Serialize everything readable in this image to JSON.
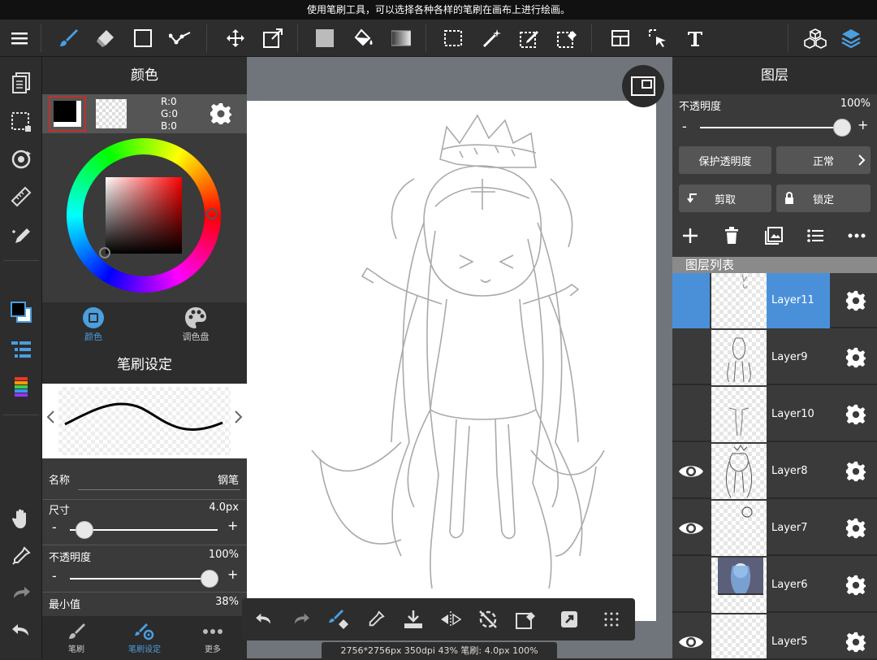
{
  "info_bar": {
    "text": "使用笔刷工具，可以选择各种各样的笔刷在画布上进行绘画。"
  },
  "color_panel": {
    "title": "颜色",
    "rgb": {
      "r": "R:0",
      "g": "G:0",
      "b": "B:0"
    },
    "tabs": [
      {
        "label": "颜色"
      },
      {
        "label": "调色盘"
      }
    ]
  },
  "brush_panel": {
    "title": "笔刷设定",
    "name_label": "名称",
    "name_value": "钢笔",
    "size_label": "尺寸",
    "size_value": "4.0px",
    "size_level": 0.1,
    "opacity_label": "不透明度",
    "opacity_value": "100%",
    "opacity_level": 1.0,
    "min_label": "最小值",
    "min_value": "38%",
    "minus": "-",
    "plus": "+"
  },
  "bottom_tabs": [
    {
      "label": "笔刷"
    },
    {
      "label": "笔刷设定"
    },
    {
      "label": "更多"
    }
  ],
  "status_bar": "2756*2756px 350dpi 43% 笔刷: 4.0px 100%",
  "layer_panel": {
    "title": "图层",
    "opacity_label": "不透明度",
    "opacity_value": "100%",
    "minus": "-",
    "plus": "+",
    "protect_alpha": "保护透明度",
    "blend_mode": "正常",
    "clip": "剪取",
    "lock": "锁定",
    "list_title": "图层列表",
    "layers": [
      {
        "name": "Layer11",
        "visible": false,
        "selected": true
      },
      {
        "name": "Layer9",
        "visible": false,
        "selected": false
      },
      {
        "name": "Layer10",
        "visible": false,
        "selected": false
      },
      {
        "name": "Layer8",
        "visible": true,
        "selected": false
      },
      {
        "name": "Layer7",
        "visible": true,
        "selected": false
      },
      {
        "name": "Layer6",
        "visible": false,
        "selected": false
      },
      {
        "name": "Layer5",
        "visible": true,
        "selected": false
      }
    ]
  },
  "colors": {
    "accent": "#4a90d9",
    "selected_swatch_border": "#c0302b"
  }
}
